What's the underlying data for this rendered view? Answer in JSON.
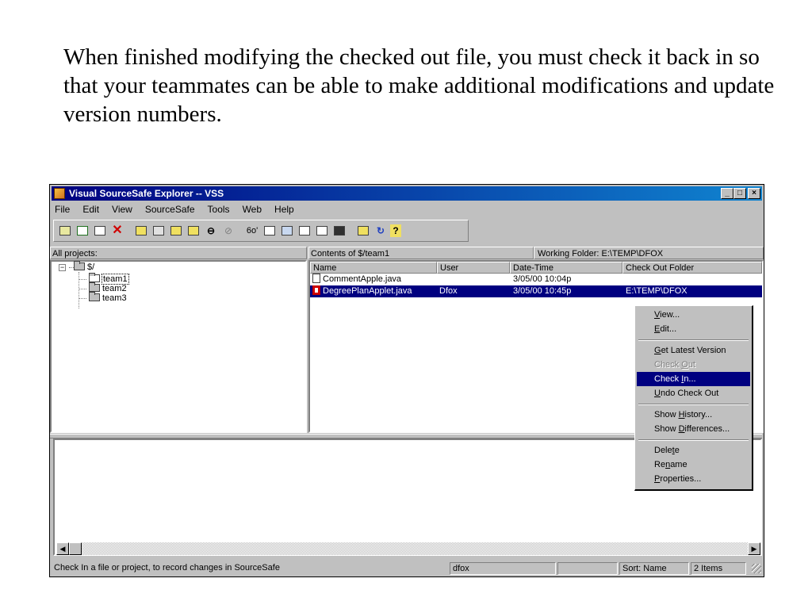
{
  "slide": {
    "caption": "When finished modifying the checked out file, you must check it back in so that your teammates can be able to make additional modifications and update version numbers."
  },
  "window": {
    "title": "Visual SourceSafe Explorer -- VSS",
    "minimize_icon": "minimize-icon",
    "maximize_icon": "maximize-icon",
    "close_icon": "close-icon"
  },
  "menu": [
    "File",
    "Edit",
    "View",
    "SourceSafe",
    "Tools",
    "Web",
    "Help"
  ],
  "toolbar": {
    "icons": [
      "create-project-icon",
      "add-files-icon",
      "copy-icon",
      "delete-icon",
      "get-latest-icon",
      "check-out-icon",
      "check-in-icon",
      "undo-check-out-icon",
      "share-icon",
      "branch-icon",
      "view-icon",
      "edit-icon",
      "history-icon",
      "properties-icon",
      "differences-icon",
      "find-icon",
      "refresh-icon",
      "help-icon"
    ]
  },
  "projects_pane": {
    "header": "All projects:",
    "tree": [
      {
        "label": "$/",
        "depth": 0,
        "expanded": true
      },
      {
        "label": "team1",
        "depth": 1,
        "selected": true
      },
      {
        "label": "team2",
        "depth": 1
      },
      {
        "label": "team3",
        "depth": 1
      }
    ]
  },
  "contents_pane": {
    "header": "Contents of $/team1",
    "working_folder": "Working Folder: E:\\TEMP\\DFOX",
    "columns": [
      "Name",
      "User",
      "Date-Time",
      "Check Out Folder"
    ],
    "rows": [
      {
        "name": "CommentApple.java",
        "user": "",
        "datetime": "3/05/00  10:04p",
        "folder": "",
        "selected": false
      },
      {
        "name": "DegreePlanApplet.java",
        "user": "Dfox",
        "datetime": "3/05/00  10:45p",
        "folder": "E:\\TEMP\\DFOX",
        "selected": true
      }
    ]
  },
  "context_menu": {
    "items": [
      {
        "label": "View...",
        "state": "normal"
      },
      {
        "label": "Edit...",
        "state": "normal"
      },
      {
        "label": "Get Latest Version",
        "state": "normal"
      },
      {
        "label": "Check Out",
        "state": "disabled"
      },
      {
        "label": "Check In...",
        "state": "highlighted"
      },
      {
        "label": "Undo Check Out",
        "state": "normal"
      },
      {
        "label": "Show History...",
        "state": "normal"
      },
      {
        "label": "Show Differences...",
        "state": "normal"
      },
      {
        "label": "Delete",
        "state": "normal"
      },
      {
        "label": "Rename",
        "state": "normal"
      },
      {
        "label": "Properties...",
        "state": "normal"
      }
    ]
  },
  "statusbar": {
    "message": "Check In a file or project, to record changes in SourceSafe",
    "user": "dfox",
    "blank": "",
    "sort": "Sort: Name",
    "count": "2 Items"
  },
  "colors": {
    "window_bg": "#c0c0c0",
    "title_active": "#000080",
    "selection": "#000080",
    "checkout_red": "#d00000"
  }
}
